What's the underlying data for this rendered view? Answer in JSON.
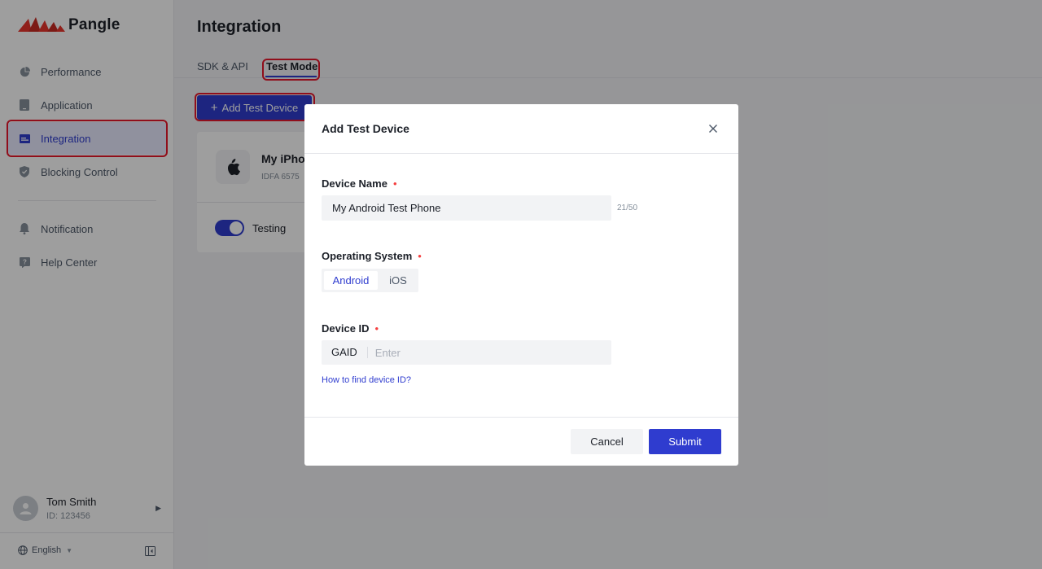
{
  "brand": {
    "name": "Pangle",
    "logo_color": "#e8352c"
  },
  "sidebar": {
    "items": [
      {
        "label": "Performance",
        "icon": "pie-chart-icon",
        "active": false
      },
      {
        "label": "Application",
        "icon": "app-icon",
        "active": false
      },
      {
        "label": "Integration",
        "icon": "integration-icon",
        "active": true
      },
      {
        "label": "Blocking Control",
        "icon": "shield-icon",
        "active": false
      },
      {
        "label": "Notification",
        "icon": "bell-icon",
        "active": false
      },
      {
        "label": "Help Center",
        "icon": "help-icon",
        "active": false
      }
    ],
    "user": {
      "name": "Tom Smith",
      "id": "ID: 123456"
    },
    "language": "English"
  },
  "main": {
    "title": "Integration",
    "tabs": [
      {
        "label": "SDK & API",
        "active": false
      },
      {
        "label": "Test Mode",
        "active": true
      }
    ],
    "add_button": "Add Test Device",
    "device_card": {
      "name": "My iPho",
      "idfa": "IDFA  6575",
      "toggle_label": "Testing",
      "toggle_on": true
    }
  },
  "modal": {
    "title": "Add Test Device",
    "device_name": {
      "label": "Device Name",
      "required": "•",
      "value": "My Android Test Phone",
      "counter": "21/50"
    },
    "os": {
      "label": "Operating System",
      "required": "•",
      "options": [
        "Android",
        "iOS"
      ],
      "selected": "Android"
    },
    "device_id": {
      "label": "Device ID",
      "required": "•",
      "prefix": "GAID",
      "placeholder": "Enter"
    },
    "help_link": "How to find device ID?",
    "cancel": "Cancel",
    "submit": "Submit"
  },
  "colors": {
    "accent": "#2f3ccf",
    "highlight": "#e8182c",
    "required": "#f53f3f"
  }
}
